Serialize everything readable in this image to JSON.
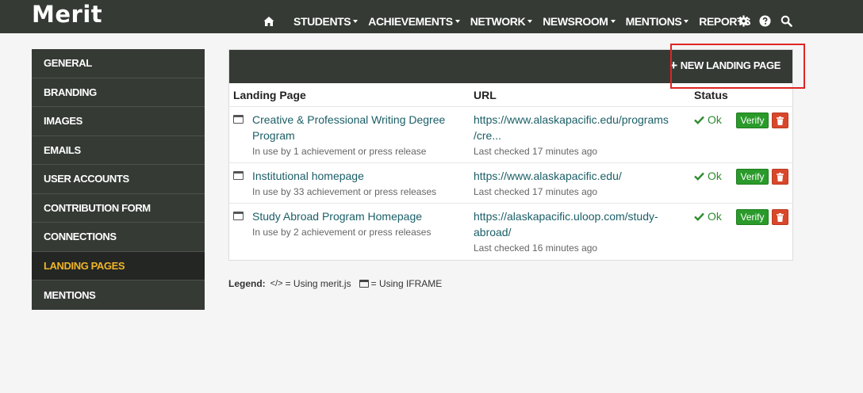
{
  "app": {
    "logo": "Merit"
  },
  "nav": {
    "items": [
      {
        "label": "STUDENTS",
        "dropdown": true
      },
      {
        "label": "ACHIEVEMENTS",
        "dropdown": true
      },
      {
        "label": "NETWORK",
        "dropdown": true
      },
      {
        "label": "NEWSROOM",
        "dropdown": true
      },
      {
        "label": "MENTIONS",
        "dropdown": true
      },
      {
        "label": "REPORTS",
        "dropdown": false
      }
    ],
    "icons": [
      "home-icon",
      "gear-icon",
      "help-icon",
      "search-icon"
    ]
  },
  "sidebar": {
    "items": [
      {
        "label": "GENERAL"
      },
      {
        "label": "BRANDING"
      },
      {
        "label": "IMAGES"
      },
      {
        "label": "EMAILS"
      },
      {
        "label": "USER ACCOUNTS"
      },
      {
        "label": "CONTRIBUTION FORM"
      },
      {
        "label": "CONNECTIONS"
      },
      {
        "label": "LANDING PAGES",
        "active": true
      },
      {
        "label": "MENTIONS"
      }
    ]
  },
  "panel": {
    "new_button_label": "NEW LANDING PAGE",
    "columns": [
      "Landing Page",
      "URL",
      "Status"
    ],
    "rows": [
      {
        "title_lines": [
          "Creative & Professional Writing Degree",
          "Program"
        ],
        "usage": "In use by 1 achievement or press release",
        "url_lines": [
          "https://www.alaskapacific.edu/programs",
          "/cre..."
        ],
        "last_checked": "Last checked 17 minutes ago",
        "status": "Ok",
        "verify_label": "Verify"
      },
      {
        "title_lines": [
          "Institutional homepage"
        ],
        "usage": "In use by 33 achievement or press releases",
        "url_lines": [
          "https://www.alaskapacific.edu/"
        ],
        "last_checked": "Last checked 17 minutes ago",
        "status": "Ok",
        "verify_label": "Verify"
      },
      {
        "title_lines": [
          "Study Abroad Program Homepage"
        ],
        "usage": "In use by 2 achievement or press releases",
        "url_lines": [
          "https://alaskapacific.uloop.com/study-",
          "abroad/"
        ],
        "last_checked": "Last checked 16 minutes ago",
        "status": "Ok",
        "verify_label": "Verify"
      }
    ]
  },
  "legend": {
    "label": "Legend:",
    "code_glyph": "</>",
    "code_text": "= Using merit.js",
    "frame_text": "= Using IFRAME"
  },
  "colors": {
    "nav_bg": "#353a35",
    "active_accent": "#f0b429",
    "link": "#1a5e66",
    "ok_green": "#2e8b2e",
    "verify_green": "#2a9a2a",
    "delete_red": "#d9472b",
    "highlight_red": "#e02424"
  }
}
